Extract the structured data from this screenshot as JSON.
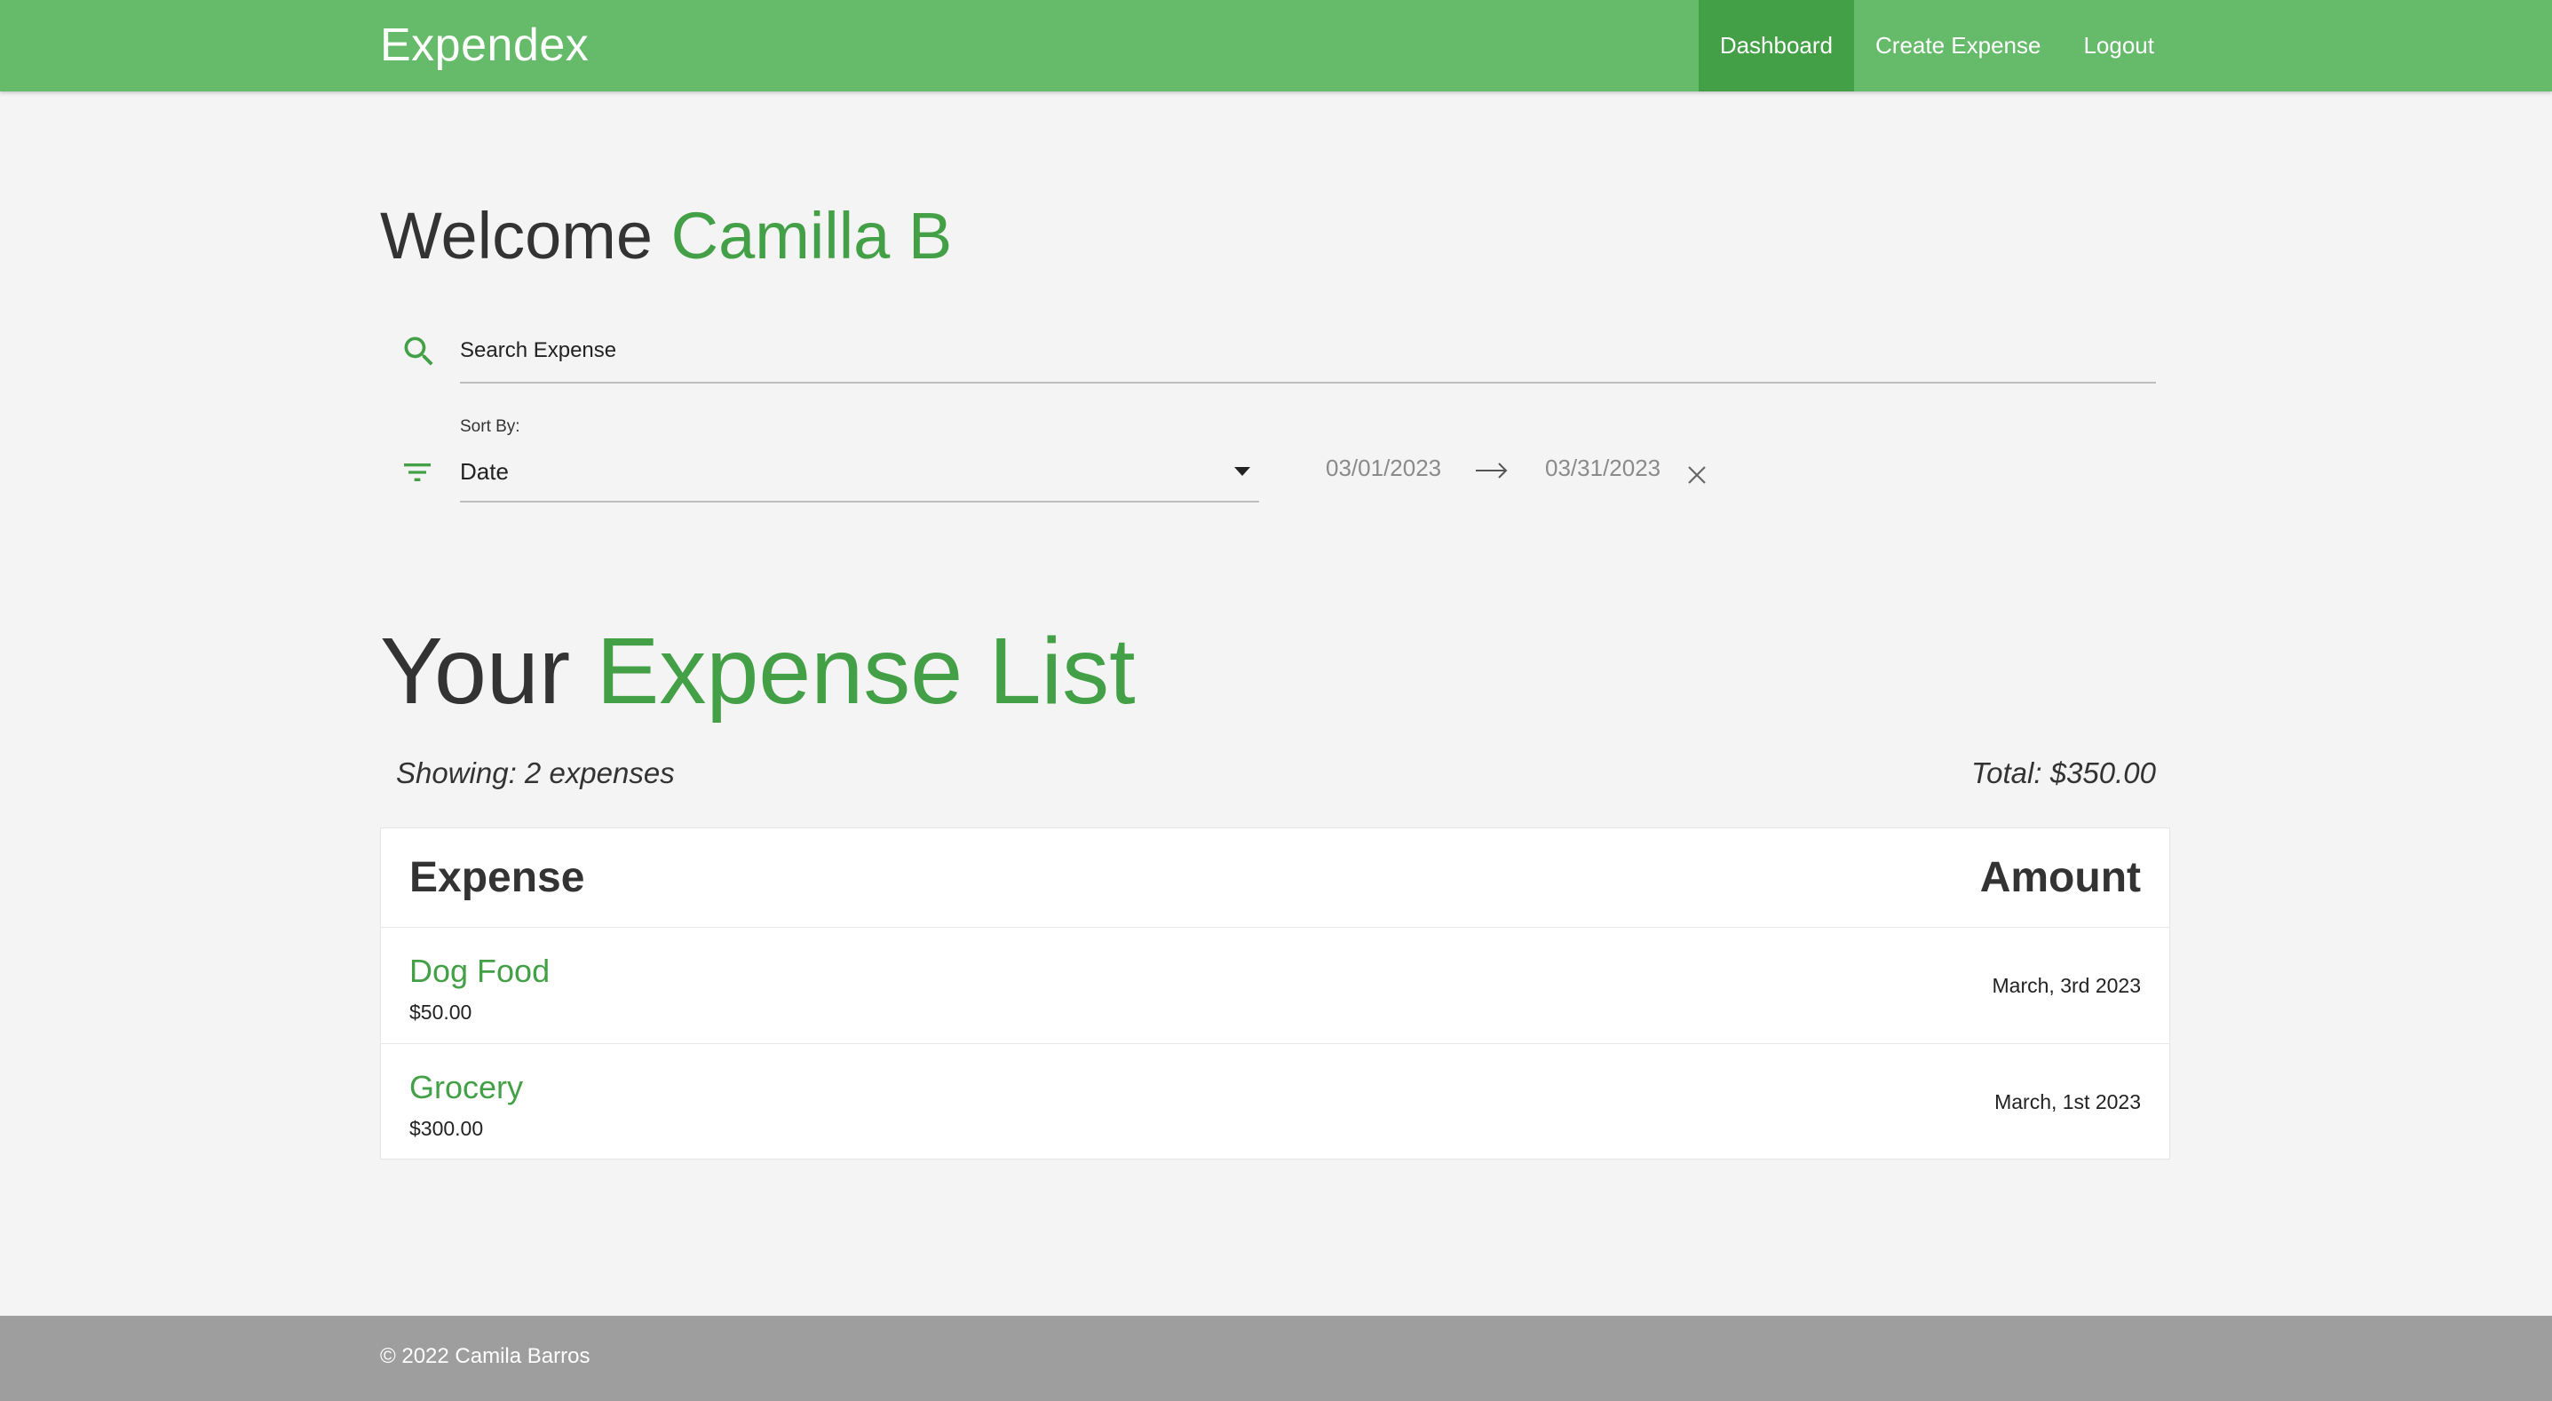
{
  "navbar": {
    "brand": "Expendex",
    "links": [
      {
        "label": "Dashboard",
        "active": true
      },
      {
        "label": "Create Expense",
        "active": false
      },
      {
        "label": "Logout",
        "active": false
      }
    ]
  },
  "welcome": {
    "prefix": "Welcome",
    "name": "Camilla B"
  },
  "search": {
    "placeholder": "Search Expense",
    "icon": "search-icon"
  },
  "sort": {
    "label": "Sort By:",
    "selected": "Date",
    "icon": "filter-icon"
  },
  "date_range": {
    "start": "03/01/2023",
    "end": "03/31/2023"
  },
  "list": {
    "title_prefix": "Your",
    "title_accent": "Expense List",
    "showing": "Showing: 2 expenses",
    "total": "Total: $350.00",
    "columns": {
      "expense": "Expense",
      "amount": "Amount"
    },
    "items": [
      {
        "name": "Dog Food",
        "amount": "$50.00",
        "date": "March, 3rd 2023"
      },
      {
        "name": "Grocery",
        "amount": "$300.00",
        "date": "March, 1st 2023"
      }
    ]
  },
  "footer": {
    "text": "© 2022 Camila Barros"
  },
  "colors": {
    "navbar": "#66bb6a",
    "nav_active": "#43a047",
    "accent": "#43a047",
    "footer": "#9e9e9e",
    "background": "#f4f4f4"
  }
}
